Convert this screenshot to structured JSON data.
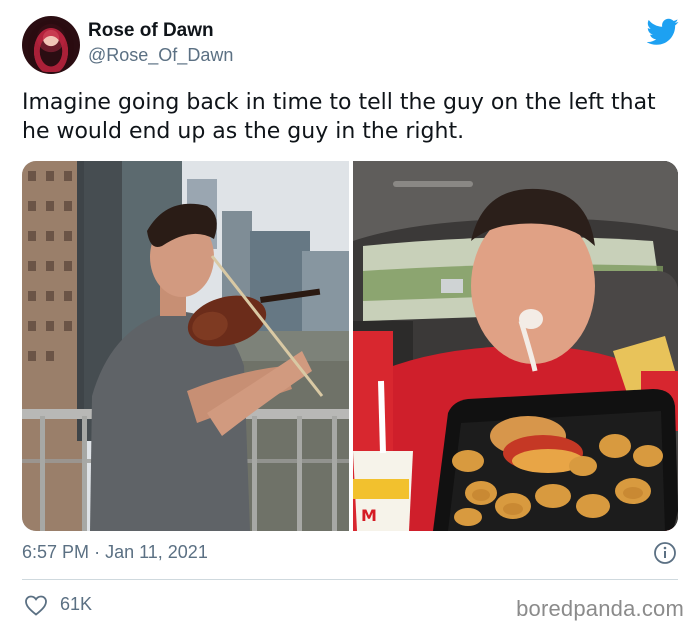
{
  "user": {
    "display_name": "Rose of Dawn",
    "handle": "@Rose_Of_Dawn"
  },
  "tweet": {
    "text": "Imagine going back in time to tell the guy on the left that he would end up as the guy in the right."
  },
  "media": {
    "images": [
      {
        "depicts": "young man in grey shirt playing violin on a city balcony"
      },
      {
        "depicts": "man in red shirt in a car with a tray of chicken nuggets, burger and a McDonald's cup"
      }
    ]
  },
  "footer": {
    "time": "6:57 PM",
    "separator": "·",
    "date": "Jan 11, 2021",
    "likes": "61K"
  },
  "watermark": "boredpanda.com",
  "colors": {
    "twitter_blue": "#1da1f2",
    "secondary_text": "#5b7083",
    "primary_text": "#0f1419"
  },
  "icons": [
    "twitter-bird-icon",
    "info-icon",
    "heart-icon"
  ]
}
